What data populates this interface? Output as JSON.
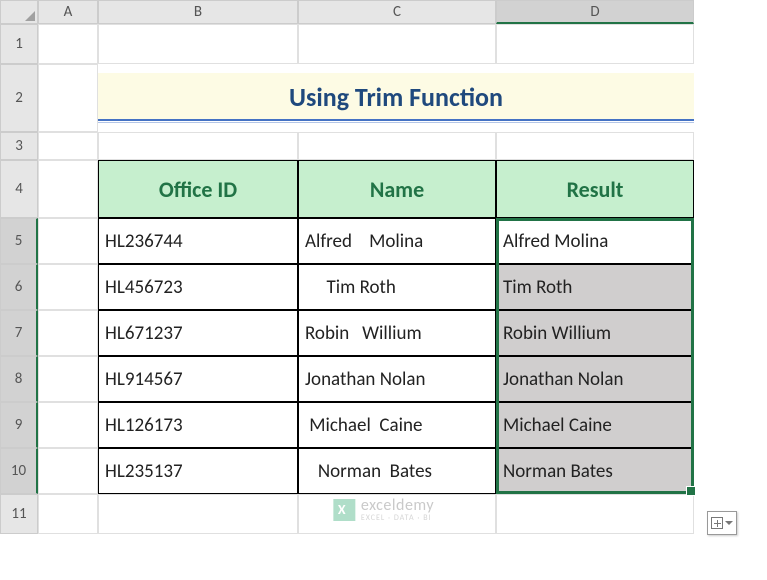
{
  "columns": [
    "A",
    "B",
    "C",
    "D"
  ],
  "rows": [
    "1",
    "2",
    "3",
    "4",
    "5",
    "6",
    "7",
    "8",
    "9",
    "10",
    "11"
  ],
  "selectedColumn": "D",
  "selectedRows": [
    "5",
    "6",
    "7",
    "8",
    "9",
    "10"
  ],
  "title": "Using Trim Function",
  "headers": {
    "B": "Office ID",
    "C": "Name",
    "D": "Result"
  },
  "data": [
    {
      "id": "HL236744",
      "name": "Alfred    Molina",
      "result": "Alfred Molina"
    },
    {
      "id": "HL456723",
      "name": "     Tim Roth",
      "result": "Tim Roth"
    },
    {
      "id": "HL671237",
      "name": "Robin   Willium",
      "result": "Robin Willium"
    },
    {
      "id": "HL914567",
      "name": "Jonathan Nolan",
      "result": "Jonathan Nolan"
    },
    {
      "id": "HL126173",
      "name": " Michael  Caine",
      "result": "Michael Caine"
    },
    {
      "id": "HL235137",
      "name": "   Norman  Bates",
      "result": "Norman Bates"
    }
  ],
  "watermark": {
    "main": "exceldemy",
    "sub": "EXCEL · DATA · BI"
  },
  "chart_data": {
    "type": "table",
    "title": "Using Trim Function",
    "columns": [
      "Office ID",
      "Name",
      "Result"
    ],
    "rows": [
      [
        "HL236744",
        "Alfred    Molina",
        "Alfred Molina"
      ],
      [
        "HL456723",
        "     Tim Roth",
        "Tim Roth"
      ],
      [
        "HL671237",
        "Robin   Willium",
        "Robin Willium"
      ],
      [
        "HL914567",
        "Jonathan Nolan",
        "Jonathan Nolan"
      ],
      [
        "HL126173",
        " Michael  Caine",
        "Michael Caine"
      ],
      [
        "HL235137",
        "   Norman  Bates",
        "Norman Bates"
      ]
    ]
  }
}
